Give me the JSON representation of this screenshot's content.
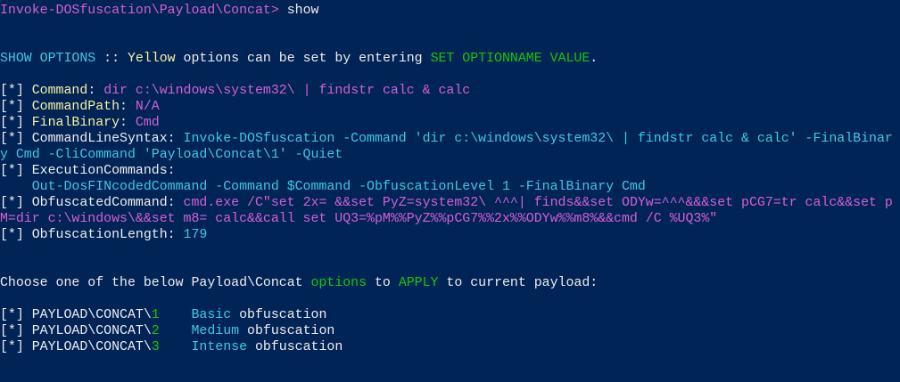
{
  "terminal": {
    "bg_color": "#012456",
    "colors": {
      "white": "#eeedf0",
      "magenta": "#d65fd6",
      "cyan": "#3fc9e0",
      "yellow": "#f9f1a5",
      "green": "#16c60c"
    },
    "lines": [
      {
        "name": "prompt-line",
        "segments": [
          {
            "text": "Invoke-DOSfuscation\\Payload\\Concat> ",
            "color": "magenta"
          },
          {
            "text": "show",
            "color": "white"
          }
        ]
      },
      {
        "name": "blank-line",
        "segments": []
      },
      {
        "name": "blank-line",
        "segments": []
      },
      {
        "name": "show-options-header",
        "segments": [
          {
            "text": "SHOW OPTIONS",
            "color": "cyan"
          },
          {
            "text": " :: ",
            "color": "white"
          },
          {
            "text": "Yellow",
            "color": "yellow"
          },
          {
            "text": " options can be set by entering ",
            "color": "white"
          },
          {
            "text": "SET OPTIONNAME VALUE",
            "color": "green"
          },
          {
            "text": ".",
            "color": "white"
          }
        ]
      },
      {
        "name": "blank-line",
        "segments": []
      },
      {
        "name": "option-command",
        "segments": [
          {
            "text": "[*] ",
            "color": "white"
          },
          {
            "text": "Command",
            "color": "yellow"
          },
          {
            "text": ": ",
            "color": "white"
          },
          {
            "text": "dir c:\\windows\\system32\\ | findstr calc & calc",
            "color": "magenta"
          }
        ]
      },
      {
        "name": "option-commandpath",
        "segments": [
          {
            "text": "[*] ",
            "color": "white"
          },
          {
            "text": "CommandPath",
            "color": "yellow"
          },
          {
            "text": ": ",
            "color": "white"
          },
          {
            "text": "N/A",
            "color": "magenta"
          }
        ]
      },
      {
        "name": "option-finalbinary",
        "segments": [
          {
            "text": "[*] ",
            "color": "white"
          },
          {
            "text": "FinalBinary",
            "color": "yellow"
          },
          {
            "text": ": ",
            "color": "white"
          },
          {
            "text": "Cmd",
            "color": "magenta"
          }
        ]
      },
      {
        "name": "option-commandlinesyntax",
        "segments": [
          {
            "text": "[*] ",
            "color": "white"
          },
          {
            "text": "CommandLineSyntax: ",
            "color": "white"
          },
          {
            "text": "Invoke-DOSfuscation -Command 'dir c:\\windows\\system32\\ | findstr calc & calc' -FinalBinar",
            "color": "cyan"
          }
        ]
      },
      {
        "name": "option-commandlinesyntax-wrap",
        "segments": [
          {
            "text": "y Cmd -CliCommand 'Payload\\Concat\\1' -Quiet",
            "color": "cyan"
          }
        ]
      },
      {
        "name": "option-executioncommands",
        "segments": [
          {
            "text": "[*] ",
            "color": "white"
          },
          {
            "text": "ExecutionCommands:",
            "color": "white"
          }
        ]
      },
      {
        "name": "option-executioncommands-value",
        "segments": [
          {
            "text": "    Out-DosFINcodedCommand -Command $Command -ObfuscationLevel 1 -FinalBinary Cmd",
            "color": "cyan"
          }
        ]
      },
      {
        "name": "option-obfuscatedcommand",
        "segments": [
          {
            "text": "[*] ",
            "color": "white"
          },
          {
            "text": "ObfuscatedCommand: ",
            "color": "white"
          },
          {
            "text": "cmd.exe /C\"set 2x= &&set PyZ=system32\\ ^^^| finds&&set ODYw=^^^&&&set pCG7=tr calc&&set p",
            "color": "magenta"
          }
        ]
      },
      {
        "name": "option-obfuscatedcommand-wrap",
        "segments": [
          {
            "text": "M=dir c:\\windows\\&&set m8= calc&&call set UQ3=%pM%%PyZ%%pCG7%%2x%%ODYw%%m8%&&cmd /C %UQ3%\"",
            "color": "magenta"
          }
        ]
      },
      {
        "name": "option-obfuscationlength",
        "segments": [
          {
            "text": "[*] ",
            "color": "white"
          },
          {
            "text": "ObfuscationLength: ",
            "color": "white"
          },
          {
            "text": "179",
            "color": "cyan"
          }
        ]
      },
      {
        "name": "blank-line",
        "segments": []
      },
      {
        "name": "blank-line",
        "segments": []
      },
      {
        "name": "choose-prompt",
        "segments": [
          {
            "text": "Choose one of the below Payload\\Concat ",
            "color": "white"
          },
          {
            "text": "options",
            "color": "green"
          },
          {
            "text": " to ",
            "color": "white"
          },
          {
            "text": "APPLY",
            "color": "green"
          },
          {
            "text": " to current payload:",
            "color": "white"
          }
        ]
      },
      {
        "name": "blank-line",
        "segments": []
      },
      {
        "name": "menu-item-1",
        "segments": [
          {
            "text": "[*] ",
            "color": "white"
          },
          {
            "text": "PAYLOAD\\CONCAT\\",
            "color": "white"
          },
          {
            "text": "1",
            "color": "green"
          },
          {
            "text": "    ",
            "color": "white"
          },
          {
            "text": "Basic",
            "color": "cyan"
          },
          {
            "text": " obfuscation",
            "color": "white"
          }
        ]
      },
      {
        "name": "menu-item-2",
        "segments": [
          {
            "text": "[*] ",
            "color": "white"
          },
          {
            "text": "PAYLOAD\\CONCAT\\",
            "color": "white"
          },
          {
            "text": "2",
            "color": "green"
          },
          {
            "text": "    ",
            "color": "white"
          },
          {
            "text": "Medium",
            "color": "cyan"
          },
          {
            "text": " obfuscation",
            "color": "white"
          }
        ]
      },
      {
        "name": "menu-item-3",
        "segments": [
          {
            "text": "[*] ",
            "color": "white"
          },
          {
            "text": "PAYLOAD\\CONCAT\\",
            "color": "white"
          },
          {
            "text": "3",
            "color": "green"
          },
          {
            "text": "    ",
            "color": "white"
          },
          {
            "text": "Intense",
            "color": "cyan"
          },
          {
            "text": " obfuscation",
            "color": "white"
          }
        ]
      }
    ]
  }
}
